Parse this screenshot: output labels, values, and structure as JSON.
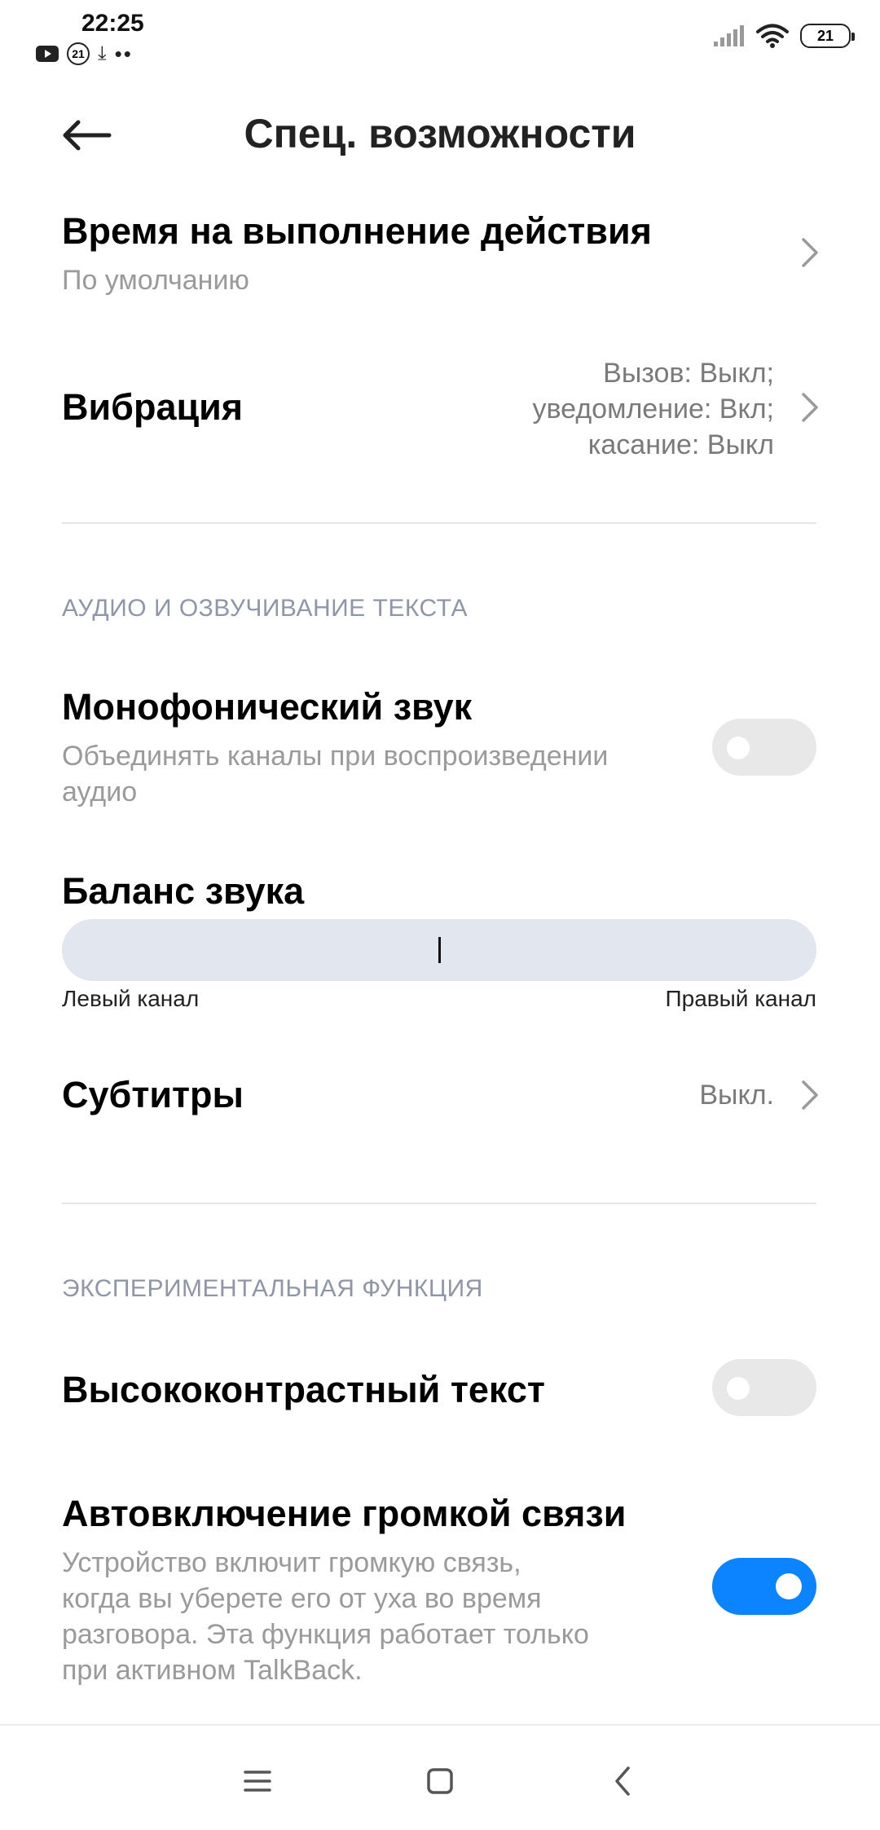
{
  "status_bar": {
    "time": "22:25",
    "notification_badge": "21",
    "battery": "21",
    "left_icons": [
      "youtube-icon",
      "badge-21-icon",
      "download-icon",
      "more-dots-icon"
    ],
    "right_icons": [
      "signal-icon",
      "wifi-icon",
      "battery-icon"
    ]
  },
  "header": {
    "title": "Спец. возможности",
    "back_icon": "arrow-left-icon"
  },
  "rows": {
    "action_time": {
      "title": "Время на выполнение действия",
      "subtitle": "По умолчанию"
    },
    "vibration": {
      "title": "Вибрация",
      "value_lines": [
        "Вызов: Выкл;",
        "уведомление: Вкл;",
        "касание: Выкл"
      ]
    },
    "mono_audio": {
      "title": "Монофонический звук",
      "subtitle_lines": [
        "Объединять каналы при воспроизведении",
        "аудио"
      ],
      "enabled": false
    },
    "balance": {
      "title": "Баланс звука",
      "left_label": "Левый канал",
      "right_label": "Правый канал",
      "position": 0.5
    },
    "subtitles": {
      "title": "Субтитры",
      "value": "Выкл."
    },
    "high_contrast": {
      "title": "Высококонтрастный текст",
      "enabled": false
    },
    "auto_speaker": {
      "title": "Автовключение громкой связи",
      "subtitle_lines": [
        "Устройство включит громкую связь,",
        "когда вы уберете его от уха во время",
        "разговора. Эта функция работает только",
        "при активном TalkBack."
      ],
      "enabled": true
    }
  },
  "sections": {
    "audio": "АУДИО И ОЗВУЧИВАНИЕ ТЕКСТА",
    "experimental": "ЭКСПЕРИМЕНТАЛЬНАЯ ФУНКЦИЯ"
  },
  "nav": {
    "icons": [
      "menu-icon",
      "home-square-icon",
      "back-chevron-icon"
    ]
  },
  "colors": {
    "accent": "#0d84ff",
    "toggle_off": "#e8e8e8",
    "section_header": "#8f96a8",
    "secondary_text": "#9a9a9a",
    "slider_track": "#e2e6ee"
  }
}
